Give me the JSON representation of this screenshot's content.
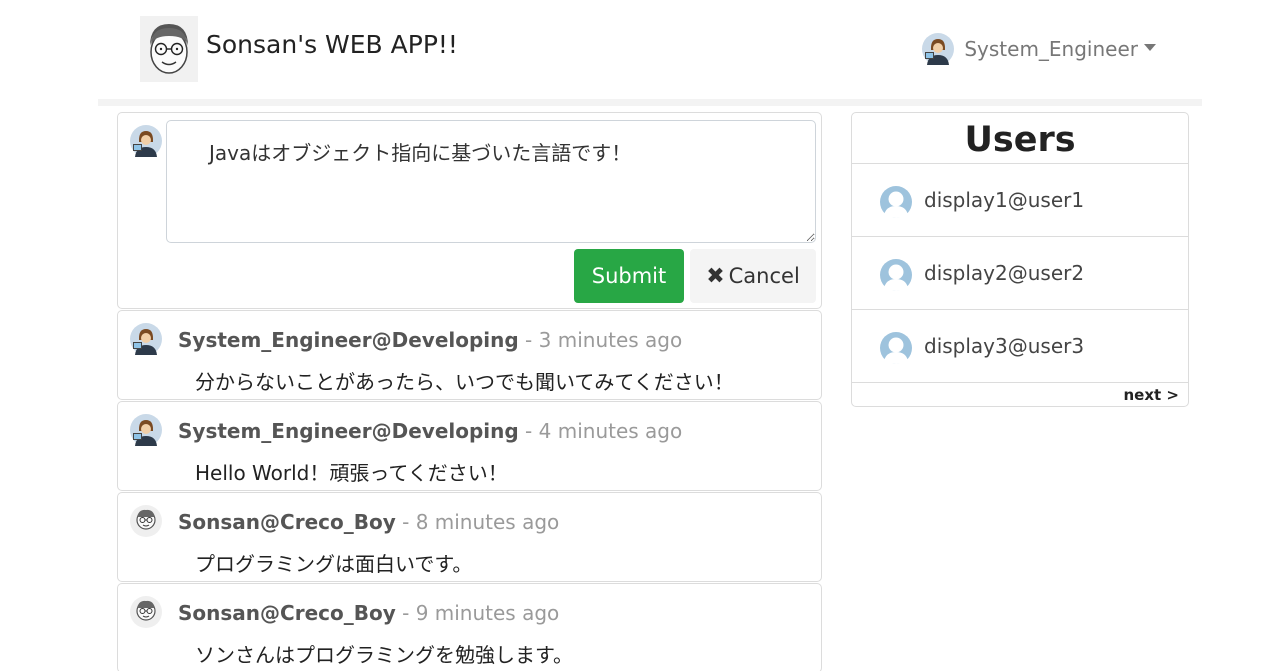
{
  "app": {
    "title": "Sonsan's WEB APP!!"
  },
  "nav": {
    "user": "System_Engineer"
  },
  "composer": {
    "value": "　Javaはオブジェクト指向に基づいた言語です！",
    "submit_label": "Submit",
    "cancel_label": "Cancel"
  },
  "posts": [
    {
      "author": "System_Engineer@Developing",
      "sep": " - ",
      "time": "3 minutes ago",
      "body": "分からないことがあったら、いつでも聞いてみてください！",
      "avatar": "engineer"
    },
    {
      "author": "System_Engineer@Developing",
      "sep": " - ",
      "time": "4 minutes ago",
      "body": "Hello World！頑張ってください！",
      "avatar": "engineer"
    },
    {
      "author": "Sonsan@Creco_Boy",
      "sep": " - ",
      "time": "8 minutes ago",
      "body": "プログラミングは面白いです。",
      "avatar": "sonsan"
    },
    {
      "author": "Sonsan@Creco_Boy",
      "sep": " - ",
      "time": "9 minutes ago",
      "body": "ソンさんはプログラミングを勉強します。",
      "avatar": "sonsan"
    }
  ],
  "users_panel": {
    "title": "Users",
    "items": [
      {
        "name": "display1@user1"
      },
      {
        "name": "display2@user2"
      },
      {
        "name": "display3@user3"
      }
    ],
    "next_label": "next >"
  },
  "colors": {
    "submit": "#28a745",
    "muted": "#9a9a9a",
    "user_icon": "#9ec3dd",
    "border": "#dcdcdc"
  }
}
